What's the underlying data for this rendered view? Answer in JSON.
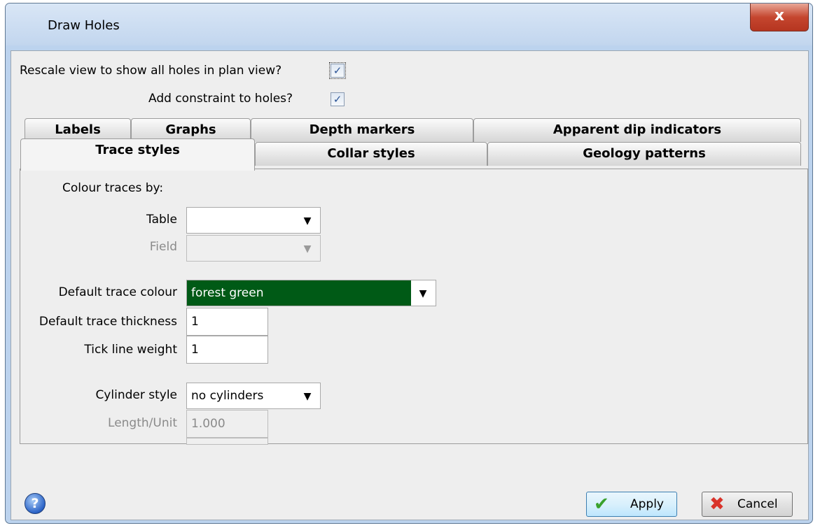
{
  "window": {
    "title": "Draw Holes",
    "close_glyph": "x"
  },
  "options": {
    "rescale_label": "Rescale view to show all holes in plan view?",
    "rescale_checked": true,
    "constraint_label": "Add constraint to holes?",
    "constraint_checked": true,
    "check_glyph": "✓"
  },
  "tabs_row1": [
    {
      "label": "Labels"
    },
    {
      "label": "Graphs"
    },
    {
      "label": "Depth markers"
    },
    {
      "label": "Apparent dip indicators"
    }
  ],
  "tabs_row2": [
    {
      "label": "Trace styles",
      "active": true
    },
    {
      "label": "Collar styles"
    },
    {
      "label": "Geology patterns"
    }
  ],
  "form": {
    "colour_by_label": "Colour traces by:",
    "table_label": "Table",
    "table_value": "",
    "field_label": "Field",
    "field_value": "",
    "default_colour_label": "Default trace colour",
    "default_colour_value": "forest green",
    "default_colour_hex": "#005a16",
    "thickness_label": "Default trace thickness",
    "thickness_value": "1",
    "tick_label": "Tick line weight",
    "tick_value": "1",
    "cylinder_label": "Cylinder style",
    "cylinder_value": "no cylinders",
    "length_label": "Length/Unit",
    "length_value": "1.000",
    "dropdown_glyph": "▼"
  },
  "buttons": {
    "help_glyph": "?",
    "apply_label": "Apply",
    "apply_icon_glyph": "✔",
    "cancel_label": "Cancel",
    "cancel_icon_glyph": "✖"
  }
}
